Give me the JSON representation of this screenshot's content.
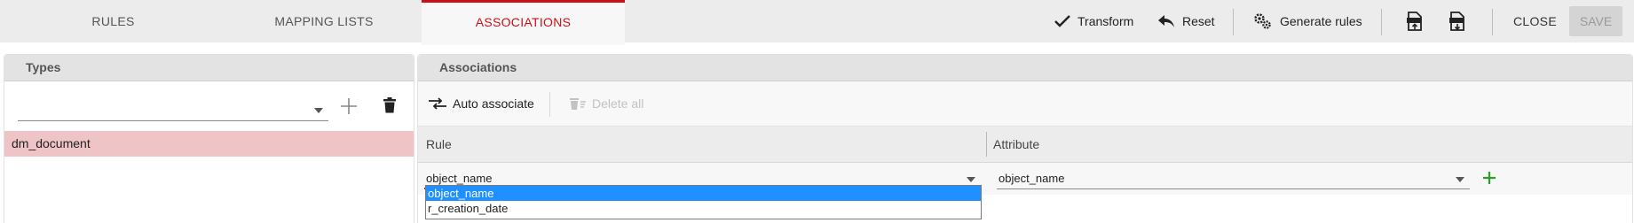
{
  "tabs": [
    {
      "label": "RULES"
    },
    {
      "label": "MAPPING LISTS"
    },
    {
      "label": "ASSOCIATIONS"
    }
  ],
  "toolbar": {
    "transform_label": "Transform",
    "reset_label": "Reset",
    "generate_rules_label": "Generate rules",
    "close_label": "CLOSE",
    "save_label": "SAVE",
    "export_xml_icon": "xml-upload-icon",
    "import_xml_icon": "xml-download-icon"
  },
  "types_panel": {
    "title": "Types",
    "select_value": "",
    "items": [
      {
        "label": "dm_document"
      }
    ]
  },
  "associations_panel": {
    "title": "Associations",
    "auto_associate_label": "Auto associate",
    "delete_all_label": "Delete all",
    "columns": {
      "rule": "Rule",
      "attribute": "Attribute"
    },
    "row": {
      "rule_value": "object_name",
      "attribute_value": "object_name"
    },
    "rule_options": [
      {
        "label": "object_name",
        "selected": true
      },
      {
        "label": "r_creation_date",
        "selected": false
      }
    ]
  },
  "colors": {
    "accent": "#cc0f17",
    "selected_row": "#eec4c6",
    "add_green": "#2e9d2e",
    "dropdown_selected": "#1e90ff"
  }
}
